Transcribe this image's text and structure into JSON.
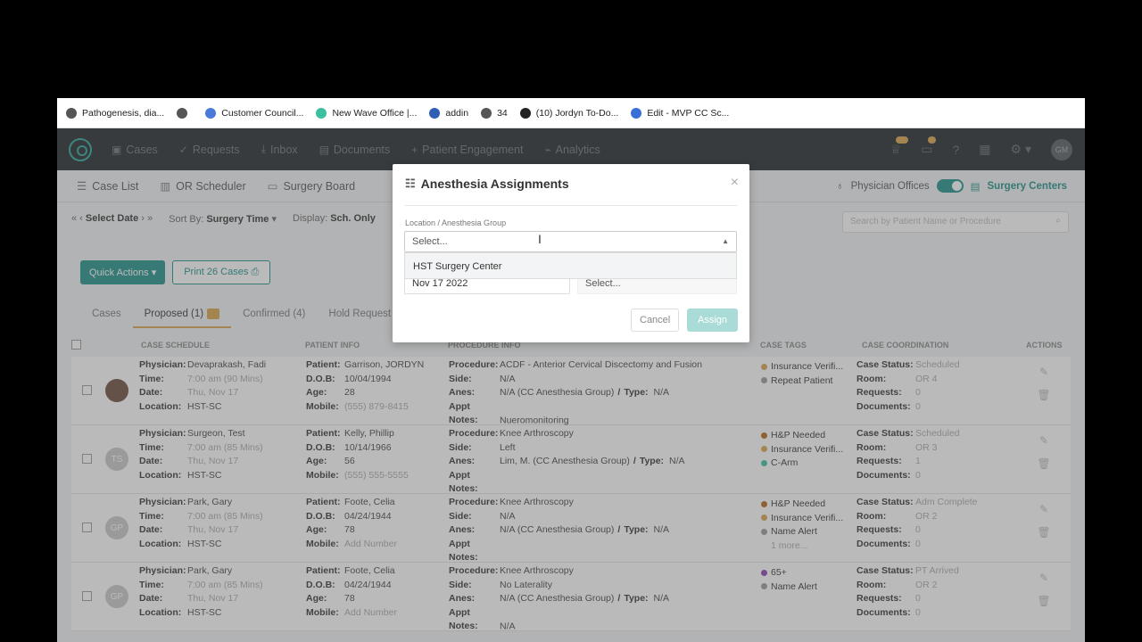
{
  "bookmarks": [
    {
      "label": "Pathogenesis, dia...",
      "color": "#555"
    },
    {
      "label": "",
      "color": "#555"
    },
    {
      "label": "Customer Council...",
      "color": "#4a7ad9"
    },
    {
      "label": "New Wave Office |...",
      "color": "#3bbfa0"
    },
    {
      "label": "addin",
      "color": "#2d5fb5"
    },
    {
      "label": "34",
      "color": "#555"
    },
    {
      "label": "(10) Jordyn To-Do...",
      "color": "#222"
    },
    {
      "label": "Edit - MVP CC Sc...",
      "color": "#3b6fd8"
    }
  ],
  "nav": {
    "items": [
      "Cases",
      "Requests",
      "Inbox",
      "Documents",
      "Patient Engagement",
      "Analytics"
    ],
    "avatar_initials": "GM"
  },
  "subnav": {
    "items": [
      "Case List",
      "OR Scheduler",
      "Surgery Board"
    ],
    "toggle_left": "Physician Offices",
    "toggle_right": "Surgery Centers"
  },
  "filters": {
    "date_label": "Select Date",
    "sort_label": "Sort By:",
    "sort_value": "Surgery Time",
    "display_label": "Display:",
    "display_value": "Sch. Only",
    "search_placeholder": "Search by Patient Name or Procedure"
  },
  "actions": {
    "quick_actions": "Quick Actions",
    "print": "Print 26 Cases"
  },
  "tabs": [
    "Cases",
    "Proposed (1)",
    "Confirmed (4)",
    "Hold Request"
  ],
  "table_headers": [
    "CASE SCHEDULE",
    "PATIENT INFO",
    "PROCEDURE INFO",
    "CASE TAGS",
    "CASE COORDINATION",
    "ACTIONS"
  ],
  "labels": {
    "physician": "Physician:",
    "time": "Time:",
    "date": "Date:",
    "location": "Location:",
    "patient": "Patient:",
    "dob": "D.O.B:",
    "age": "Age:",
    "mobile": "Mobile:",
    "procedure": "Procedure:",
    "side": "Side:",
    "anes": "Anes:",
    "appt_notes": "Appt Notes:",
    "type": "Type:",
    "case_status": "Case Status:",
    "room": "Room:",
    "requests": "Requests:",
    "documents": "Documents:"
  },
  "rows": [
    {
      "initials": "",
      "physician": "Devaprakash, Fadi",
      "time": "7:00 am (90 Mins)",
      "date": "Thu, Nov 17",
      "location": "HST-SC",
      "patient": "Garrison, JORDYN",
      "dob": "10/04/1994",
      "age": "28",
      "mobile": "(555) 879-8415",
      "procedure": "ACDF - Anterior Cervical Discectomy and Fusion",
      "side": "N/A",
      "anes": "N/A (CC Anesthesia Group)",
      "type_val": "N/A",
      "appt_notes": "Nueromonitoring",
      "tags": [
        {
          "label": "Insurance Verifi...",
          "color": "#d9a24a"
        },
        {
          "label": "Repeat Patient",
          "color": "#999999"
        }
      ],
      "case_status": "Scheduled",
      "room": "OR 4",
      "requests": "0",
      "documents": "0"
    },
    {
      "initials": "TS",
      "physician": "Surgeon, Test",
      "time": "7:00 am (85 Mins)",
      "date": "Thu, Nov 17",
      "location": "HST-SC",
      "patient": "Kelly, Phillip",
      "dob": "10/14/1966",
      "age": "56",
      "mobile": "(555) 555-5555",
      "procedure": "Knee Arthroscopy",
      "side": "Left",
      "anes": "Lim, M. (CC Anesthesia Group)",
      "type_val": "N/A",
      "appt_notes": "",
      "tags": [
        {
          "label": "H&P Needed",
          "color": "#b5651d"
        },
        {
          "label": "Insurance Verifi...",
          "color": "#d9a24a"
        },
        {
          "label": "C-Arm",
          "color": "#3bbfa0"
        }
      ],
      "case_status": "Scheduled",
      "room": "OR 3",
      "requests": "1",
      "documents": "0"
    },
    {
      "initials": "GP",
      "physician": "Park, Gary",
      "time": "7:00 am (85 Mins)",
      "date": "Thu, Nov 17",
      "location": "HST-SC",
      "patient": "Foote, Celia",
      "dob": "04/24/1944",
      "age": "78",
      "mobile": "Add Number",
      "procedure": "Knee Arthroscopy",
      "side": "N/A",
      "anes": "N/A (CC Anesthesia Group)",
      "type_val": "N/A",
      "appt_notes": "",
      "tags": [
        {
          "label": "H&P Needed",
          "color": "#b5651d"
        },
        {
          "label": "Insurance Verifi...",
          "color": "#d9a24a"
        },
        {
          "label": "Name Alert",
          "color": "#999999"
        },
        {
          "label": "1 more...",
          "color": ""
        }
      ],
      "case_status": "Adm Complete",
      "room": "OR 2",
      "requests": "0",
      "documents": "0"
    },
    {
      "initials": "GP",
      "physician": "Park, Gary",
      "time": "7:00 am (85 Mins)",
      "date": "Thu, Nov 17",
      "location": "HST-SC",
      "patient": "Foote, Celia",
      "dob": "04/24/1944",
      "age": "78",
      "mobile": "Add Number",
      "procedure": "Knee Arthroscopy",
      "side": "No Laterality",
      "anes": "N/A (CC Anesthesia Group)",
      "type_val": "N/A",
      "appt_notes": "N/A",
      "tags": [
        {
          "label": "65+",
          "color": "#8e3fb0"
        },
        {
          "label": "Name Alert",
          "color": "#999999"
        }
      ],
      "case_status": "PT Arrived",
      "room": "OR 2",
      "requests": "0",
      "documents": "0"
    }
  ],
  "modal": {
    "title": "Anesthesia Assignments",
    "field_label": "Location / Anesthesia Group",
    "select_placeholder": "Select...",
    "dropdown_option": "HST Surgery Center",
    "date_value": "Nov 17 2022",
    "select2_placeholder": "Select...",
    "cancel": "Cancel",
    "assign": "Assign"
  }
}
